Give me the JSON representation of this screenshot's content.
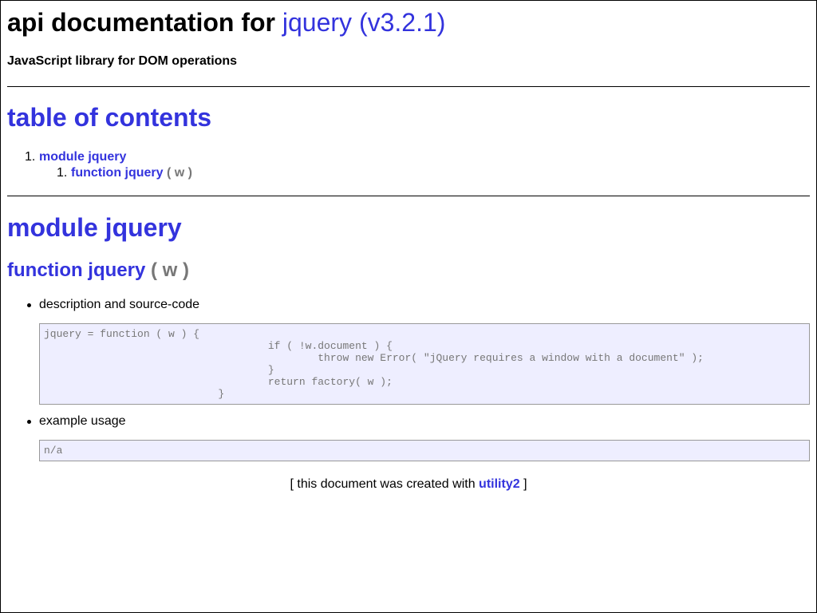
{
  "header": {
    "title_prefix": "api documentation for",
    "title_link": "jquery (v3.2.1)",
    "subtitle": "JavaScript library for DOM operations"
  },
  "toc": {
    "title": "table of contents",
    "items": [
      {
        "number": "1.",
        "label": "module jquery",
        "subitems": [
          {
            "number": "1.",
            "label": "function jquery",
            "args": "( w )"
          }
        ]
      }
    ]
  },
  "module": {
    "title": "module jquery",
    "function": {
      "name": "function jquery",
      "args": "( w )",
      "description_label": "description and source-code",
      "source_code": "jquery = function ( w ) {\n                                    if ( !w.document ) {\n                                            throw new Error( \"jQuery requires a window with a document\" );\n                                    }\n                                    return factory( w );\n                            }",
      "example_label": "example usage",
      "example_code": "n/a"
    }
  },
  "footer": {
    "prefix": "[ this document was created with",
    "link": "utility2",
    "suffix": "]"
  },
  "colors": {
    "link": "#3333dd",
    "args": "#777777",
    "code_background": "#eeeeff",
    "code_border": "#999999"
  }
}
